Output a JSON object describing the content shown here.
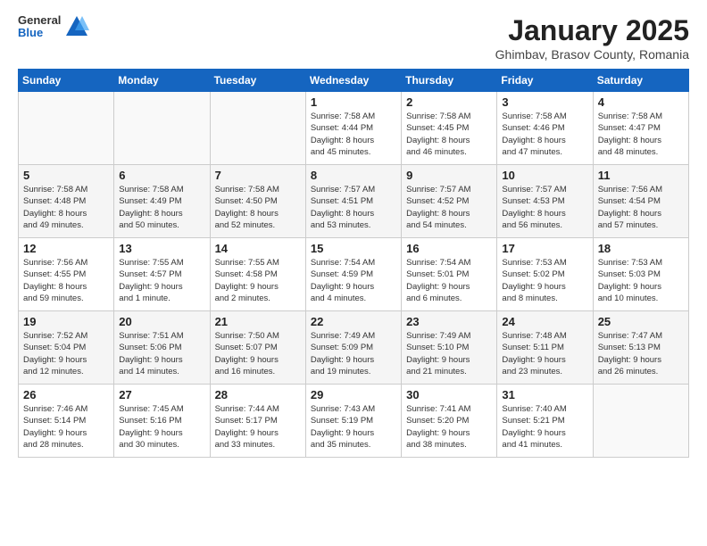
{
  "header": {
    "logo_general": "General",
    "logo_blue": "Blue",
    "title": "January 2025",
    "subtitle": "Ghimbav, Brasov County, Romania"
  },
  "weekdays": [
    "Sunday",
    "Monday",
    "Tuesday",
    "Wednesday",
    "Thursday",
    "Friday",
    "Saturday"
  ],
  "weeks": [
    [
      {
        "day": "",
        "info": ""
      },
      {
        "day": "",
        "info": ""
      },
      {
        "day": "",
        "info": ""
      },
      {
        "day": "1",
        "info": "Sunrise: 7:58 AM\nSunset: 4:44 PM\nDaylight: 8 hours\nand 45 minutes."
      },
      {
        "day": "2",
        "info": "Sunrise: 7:58 AM\nSunset: 4:45 PM\nDaylight: 8 hours\nand 46 minutes."
      },
      {
        "day": "3",
        "info": "Sunrise: 7:58 AM\nSunset: 4:46 PM\nDaylight: 8 hours\nand 47 minutes."
      },
      {
        "day": "4",
        "info": "Sunrise: 7:58 AM\nSunset: 4:47 PM\nDaylight: 8 hours\nand 48 minutes."
      }
    ],
    [
      {
        "day": "5",
        "info": "Sunrise: 7:58 AM\nSunset: 4:48 PM\nDaylight: 8 hours\nand 49 minutes."
      },
      {
        "day": "6",
        "info": "Sunrise: 7:58 AM\nSunset: 4:49 PM\nDaylight: 8 hours\nand 50 minutes."
      },
      {
        "day": "7",
        "info": "Sunrise: 7:58 AM\nSunset: 4:50 PM\nDaylight: 8 hours\nand 52 minutes."
      },
      {
        "day": "8",
        "info": "Sunrise: 7:57 AM\nSunset: 4:51 PM\nDaylight: 8 hours\nand 53 minutes."
      },
      {
        "day": "9",
        "info": "Sunrise: 7:57 AM\nSunset: 4:52 PM\nDaylight: 8 hours\nand 54 minutes."
      },
      {
        "day": "10",
        "info": "Sunrise: 7:57 AM\nSunset: 4:53 PM\nDaylight: 8 hours\nand 56 minutes."
      },
      {
        "day": "11",
        "info": "Sunrise: 7:56 AM\nSunset: 4:54 PM\nDaylight: 8 hours\nand 57 minutes."
      }
    ],
    [
      {
        "day": "12",
        "info": "Sunrise: 7:56 AM\nSunset: 4:55 PM\nDaylight: 8 hours\nand 59 minutes."
      },
      {
        "day": "13",
        "info": "Sunrise: 7:55 AM\nSunset: 4:57 PM\nDaylight: 9 hours\nand 1 minute."
      },
      {
        "day": "14",
        "info": "Sunrise: 7:55 AM\nSunset: 4:58 PM\nDaylight: 9 hours\nand 2 minutes."
      },
      {
        "day": "15",
        "info": "Sunrise: 7:54 AM\nSunset: 4:59 PM\nDaylight: 9 hours\nand 4 minutes."
      },
      {
        "day": "16",
        "info": "Sunrise: 7:54 AM\nSunset: 5:01 PM\nDaylight: 9 hours\nand 6 minutes."
      },
      {
        "day": "17",
        "info": "Sunrise: 7:53 AM\nSunset: 5:02 PM\nDaylight: 9 hours\nand 8 minutes."
      },
      {
        "day": "18",
        "info": "Sunrise: 7:53 AM\nSunset: 5:03 PM\nDaylight: 9 hours\nand 10 minutes."
      }
    ],
    [
      {
        "day": "19",
        "info": "Sunrise: 7:52 AM\nSunset: 5:04 PM\nDaylight: 9 hours\nand 12 minutes."
      },
      {
        "day": "20",
        "info": "Sunrise: 7:51 AM\nSunset: 5:06 PM\nDaylight: 9 hours\nand 14 minutes."
      },
      {
        "day": "21",
        "info": "Sunrise: 7:50 AM\nSunset: 5:07 PM\nDaylight: 9 hours\nand 16 minutes."
      },
      {
        "day": "22",
        "info": "Sunrise: 7:49 AM\nSunset: 5:09 PM\nDaylight: 9 hours\nand 19 minutes."
      },
      {
        "day": "23",
        "info": "Sunrise: 7:49 AM\nSunset: 5:10 PM\nDaylight: 9 hours\nand 21 minutes."
      },
      {
        "day": "24",
        "info": "Sunrise: 7:48 AM\nSunset: 5:11 PM\nDaylight: 9 hours\nand 23 minutes."
      },
      {
        "day": "25",
        "info": "Sunrise: 7:47 AM\nSunset: 5:13 PM\nDaylight: 9 hours\nand 26 minutes."
      }
    ],
    [
      {
        "day": "26",
        "info": "Sunrise: 7:46 AM\nSunset: 5:14 PM\nDaylight: 9 hours\nand 28 minutes."
      },
      {
        "day": "27",
        "info": "Sunrise: 7:45 AM\nSunset: 5:16 PM\nDaylight: 9 hours\nand 30 minutes."
      },
      {
        "day": "28",
        "info": "Sunrise: 7:44 AM\nSunset: 5:17 PM\nDaylight: 9 hours\nand 33 minutes."
      },
      {
        "day": "29",
        "info": "Sunrise: 7:43 AM\nSunset: 5:19 PM\nDaylight: 9 hours\nand 35 minutes."
      },
      {
        "day": "30",
        "info": "Sunrise: 7:41 AM\nSunset: 5:20 PM\nDaylight: 9 hours\nand 38 minutes."
      },
      {
        "day": "31",
        "info": "Sunrise: 7:40 AM\nSunset: 5:21 PM\nDaylight: 9 hours\nand 41 minutes."
      },
      {
        "day": "",
        "info": ""
      }
    ]
  ]
}
